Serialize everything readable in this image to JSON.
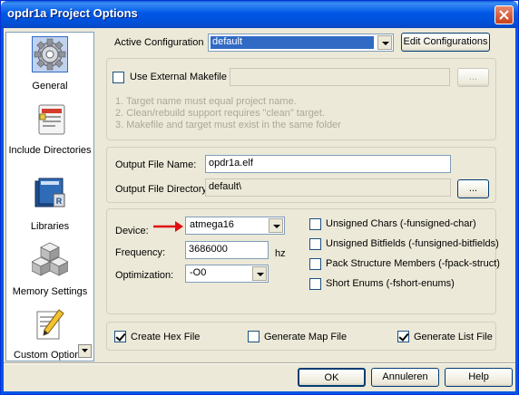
{
  "window": {
    "title": "opdr1a Project Options"
  },
  "sidebar": {
    "items": [
      {
        "label": "General",
        "icon": "gear-icon"
      },
      {
        "label": "Include Directories",
        "icon": "include-directories-icon"
      },
      {
        "label": "Libraries",
        "icon": "libraries-icon"
      },
      {
        "label": "Memory Settings",
        "icon": "memory-settings-icon"
      },
      {
        "label": "Custom Options",
        "icon": "custom-options-icon"
      }
    ]
  },
  "config": {
    "active_label": "Active Configuration",
    "active_value": "default",
    "edit_button": "Edit Configurations"
  },
  "makefile": {
    "use_external_label": "Use External Makefile",
    "path_value": "",
    "browse_label": "...",
    "notes": [
      "1. Target name must equal project name.",
      "2. Clean/rebuild support requires \"clean\" target.",
      "3. Makefile and target must exist in the same folder"
    ]
  },
  "output": {
    "file_name_label": "Output File Name:",
    "file_name_value": "opdr1a.elf",
    "directory_label": "Output File Directory:",
    "directory_value": "default\\",
    "browse_label": "..."
  },
  "device": {
    "device_label": "Device:",
    "device_value": "atmega16",
    "frequency_label": "Frequency:",
    "frequency_value": "3686000",
    "frequency_unit": "hz",
    "optimization_label": "Optimization:",
    "optimization_value": "-O0"
  },
  "compiler_flags": [
    {
      "label": "Unsigned Chars (-funsigned-char)",
      "checked": false
    },
    {
      "label": "Unsigned Bitfields (-funsigned-bitfields)",
      "checked": false
    },
    {
      "label": "Pack Structure Members (-fpack-struct)",
      "checked": false
    },
    {
      "label": "Short Enums (-fshort-enums)",
      "checked": false
    }
  ],
  "outputs": [
    {
      "label": "Create Hex File",
      "checked": true
    },
    {
      "label": "Generate Map File",
      "checked": false
    },
    {
      "label": "Generate List File",
      "checked": true
    }
  ],
  "buttons": {
    "ok": "OK",
    "cancel": "Annuleren",
    "help": "Help"
  },
  "colors": {
    "title_bar": "#0058e6",
    "selection": "#316ac5",
    "arrow": "#e01010"
  }
}
